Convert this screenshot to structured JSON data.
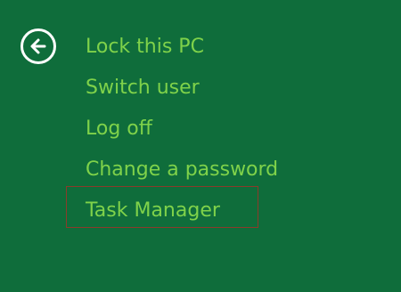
{
  "screen": {
    "background_color": "#0f6d3b",
    "text_color": "#7fd24a",
    "selection_border_color": "#8a3b2a"
  },
  "back_button": {
    "icon": "back-arrow-icon"
  },
  "menu": {
    "items": [
      {
        "label": "Lock this PC"
      },
      {
        "label": "Switch user"
      },
      {
        "label": "Log off"
      },
      {
        "label": "Change a password"
      },
      {
        "label": "Task Manager",
        "selected": true
      }
    ]
  }
}
